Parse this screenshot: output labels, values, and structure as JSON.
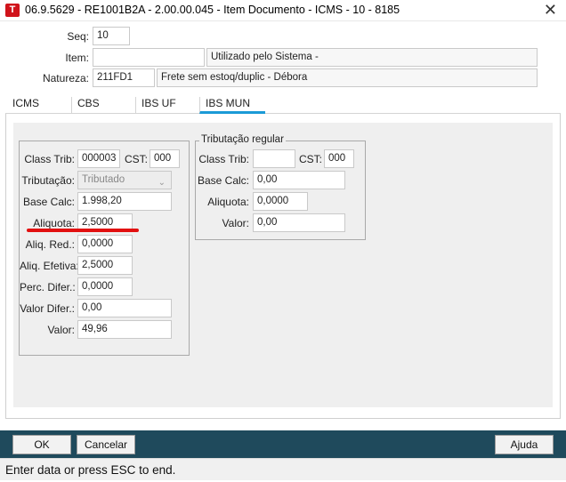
{
  "window": {
    "title": "06.9.5629 - RE1001B2A - 2.00.00.045 - Item Documento - ICMS - 10 - 8185",
    "app_icon": "T",
    "close": "✕"
  },
  "header": {
    "seq_label": "Seq:",
    "seq_value": "10",
    "item_label": "Item:",
    "item_value": "",
    "item_desc": "Utilizado pelo Sistema -",
    "natureza_label": "Natureza:",
    "natureza_value": "211FD1",
    "natureza_desc": "Frete sem estoq/duplic - Débora"
  },
  "tabs": [
    {
      "label": "ICMS",
      "active": false
    },
    {
      "label": "CBS",
      "active": false
    },
    {
      "label": "IBS UF",
      "active": false
    },
    {
      "label": "IBS MUN",
      "active": true
    }
  ],
  "left_group": {
    "class_trib_label": "Class Trib:",
    "class_trib_value": "000003",
    "cst_label": "CST:",
    "cst_value": "000",
    "tributacao_label": "Tributação:",
    "tributacao_value": "Tributado",
    "base_calc_label": "Base Calc:",
    "base_calc_value": "1.998,20",
    "aliquota_label": "Aliquota:",
    "aliquota_value": "2,5000",
    "aliq_red_label": "Aliq. Red.:",
    "aliq_red_value": "0,0000",
    "aliq_efetiva_label": "Aliq. Efetiva:",
    "aliq_efetiva_value": "2,5000",
    "perc_difer_label": "Perc. Difer.:",
    "perc_difer_value": "0,0000",
    "valor_difer_label": "Valor Difer.:",
    "valor_difer_value": "0,00",
    "valor_label": "Valor:",
    "valor_value": "49,96"
  },
  "right_group": {
    "title": "Tributação regular",
    "class_trib_label": "Class Trib:",
    "class_trib_value": "",
    "cst_label": "CST:",
    "cst_value": "000",
    "base_calc_label": "Base Calc:",
    "base_calc_value": "0,00",
    "aliquota_label": "Aliquota:",
    "aliquota_value": "0,0000",
    "valor_label": "Valor:",
    "valor_value": "0,00"
  },
  "buttons": {
    "ok": "OK",
    "cancelar": "Cancelar",
    "ajuda": "Ajuda"
  },
  "status": "Enter data or press ESC to end.",
  "colors": {
    "accent": "#1b9ad6",
    "bottom_bar": "#1f4a5c",
    "highlight_red": "#e21010",
    "app_icon": "#d0131b"
  }
}
